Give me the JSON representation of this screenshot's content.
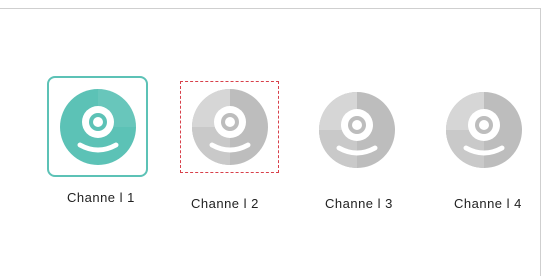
{
  "channels": [
    {
      "label": "Channe l 1",
      "icon": "camera-icon",
      "state": "selected",
      "color": "#5cc2b6"
    },
    {
      "label": "Channe l 2",
      "icon": "camera-icon",
      "state": "focused",
      "color": "#bdbdbd"
    },
    {
      "label": "Channe l 3",
      "icon": "camera-icon",
      "state": "normal",
      "color": "#bdbdbd"
    },
    {
      "label": "Channe l 4",
      "icon": "camera-icon",
      "state": "normal",
      "color": "#bdbdbd"
    }
  ],
  "colors": {
    "accent": "#5cc2b6",
    "inactive": "#bdbdbd",
    "focus_outline": "#d8404a"
  }
}
